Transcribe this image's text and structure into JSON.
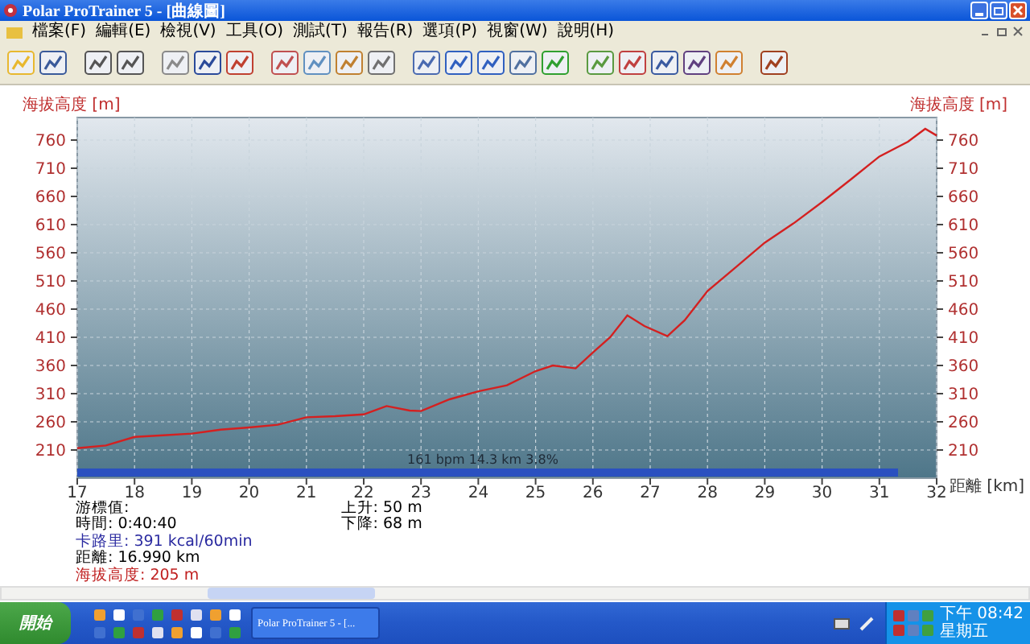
{
  "window": {
    "title": "Polar ProTrainer 5 - [曲線圖]"
  },
  "menu": [
    "檔案(F)",
    "編輯(E)",
    "檢視(V)",
    "工具(O)",
    "測試(T)",
    "報告(R)",
    "選項(P)",
    "視窗(W)",
    "說明(H)"
  ],
  "chart": {
    "right_axis_label": "海拔高度 [m]",
    "right_axis_ticks": [
      "760",
      "710",
      "660",
      "610",
      "560",
      "510",
      "460",
      "410",
      "360",
      "310",
      "260",
      "210"
    ],
    "band": {
      "label": "161 bpm 14.3 km 3.8%"
    },
    "chart_data": {
      "type": "line",
      "grid": true,
      "ylabel": "海拔高度 [m]",
      "xlabel": "距離 [km]",
      "xlim": [
        17,
        32
      ],
      "ylim": [
        160,
        800
      ],
      "xticks": [
        17,
        18,
        19,
        20,
        21,
        22,
        23,
        24,
        25,
        26,
        27,
        28,
        29,
        30,
        31,
        32
      ],
      "yticks": [
        210,
        260,
        310,
        360,
        410,
        460,
        510,
        560,
        610,
        660,
        710,
        760
      ],
      "x": [
        17,
        17.5,
        18,
        18.5,
        19,
        19.5,
        20,
        20.5,
        21,
        21.5,
        22,
        22.4,
        22.8,
        23,
        23.5,
        24,
        24.5,
        25,
        25.3,
        25.7,
        26,
        26.3,
        26.6,
        26.9,
        27.3,
        27.6,
        28,
        28.5,
        29,
        29.5,
        30,
        30.5,
        31,
        31.5,
        31.8,
        32
      ],
      "series": [
        {
          "color": "#d42020",
          "values": [
            213,
            218,
            233,
            236,
            239,
            246,
            250,
            255,
            268,
            270,
            273,
            288,
            280,
            279,
            300,
            314,
            325,
            350,
            360,
            355,
            383,
            410,
            449,
            430,
            412,
            440,
            492,
            535,
            578,
            612,
            650,
            690,
            731,
            757,
            780,
            768
          ]
        }
      ]
    }
  },
  "info": {
    "heading": "游標值:",
    "left": [
      {
        "text": "時間: 0:40:40",
        "color": "#000000"
      },
      {
        "text": "卡路里: 391 kcal/60min",
        "color": "#2a2aa0"
      },
      {
        "text": "距離: 16.990 km",
        "color": "#000000"
      },
      {
        "text": "海拔高度: 205 m",
        "color": "#c02020"
      }
    ],
    "right": [
      {
        "text": "上升: 50 m",
        "color": "#000000"
      },
      {
        "text": "下降: 68 m",
        "color": "#000000"
      }
    ]
  },
  "taskbar": {
    "start": "開始",
    "task": "Polar ProTrainer 5 - [...",
    "time": "下午 08:42",
    "day": "星期五"
  }
}
